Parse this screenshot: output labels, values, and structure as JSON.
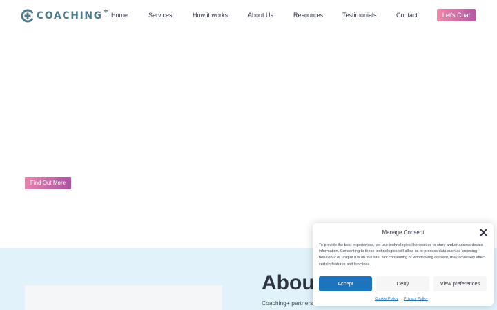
{
  "header": {
    "logo_text": "COACHING",
    "logo_plus": "+",
    "nav": [
      "Home",
      "Services",
      "How it works",
      "About Us",
      "Resources",
      "Testimonials",
      "Contact"
    ],
    "cta_label": "Let's Chat"
  },
  "hero": {
    "button_label": "Find Out More"
  },
  "about": {
    "heading": "About",
    "text": "Coaching+ partners"
  },
  "consent": {
    "title": "Manage Consent",
    "body": "To provide the best experiences, we use technologies like cookies to store and/or access device information. Consenting to these technologies will allow us to process data such as browsing behaviour or unique IDs on this site. Not consenting or withdrawing consent, may adversely affect certain features and functions.",
    "accept_label": "Accept",
    "deny_label": "Deny",
    "prefs_label": "View preferences",
    "cookie_policy_label": "Cookie Policy",
    "privacy_policy_label": "Privacy Policy"
  },
  "colors": {
    "brand": "#4d7a8e",
    "cta_gradient_start": "#ef87a8",
    "cta_gradient_end": "#b45aa6",
    "accept": "#1e73be",
    "about_band": "#e1f2fa"
  },
  "icons": {
    "logo": "circle-plus-icon",
    "close": "close-icon"
  }
}
